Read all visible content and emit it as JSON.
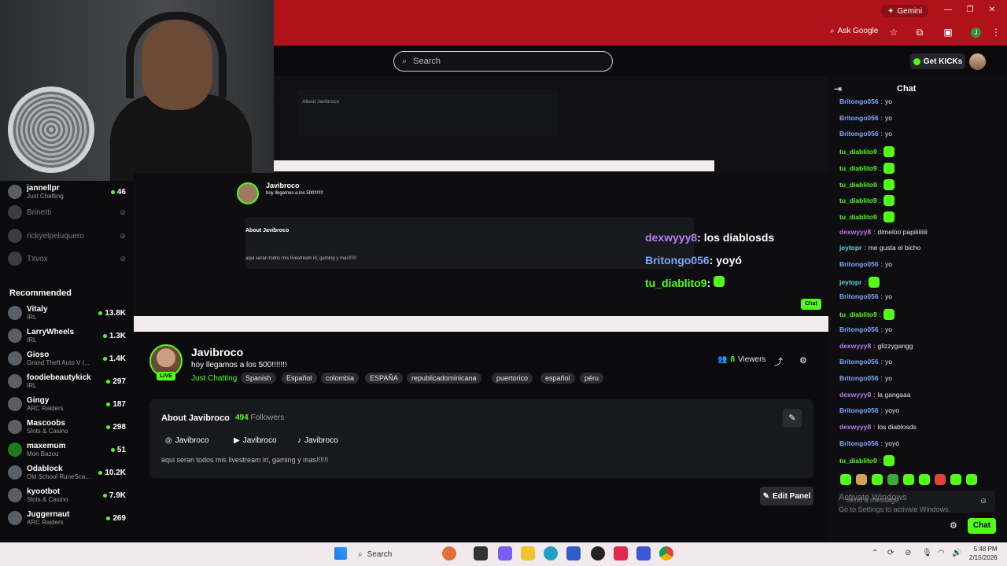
{
  "browser": {
    "gemini_label": "Gemini",
    "ask_google_label": "Ask Google",
    "profile_initial": "J"
  },
  "header": {
    "search_placeholder": "Search",
    "get_kicks_label": "Get KICKs"
  },
  "sidebar": {
    "following": [
      {
        "name": "jannellpr",
        "category": "Just Chatting",
        "viewers": "46",
        "live": true
      },
      {
        "name": "Brinetti",
        "live": false
      },
      {
        "name": "rickyelpeluquero",
        "live": false
      },
      {
        "name": "Txvox",
        "live": false
      }
    ],
    "recommended_label": "Recommended",
    "recommended": [
      {
        "name": "Vitaly",
        "category": "IRL",
        "viewers": "13.8K"
      },
      {
        "name": "LarryWheels",
        "category": "IRL",
        "viewers": "1.3K"
      },
      {
        "name": "Gioso",
        "category": "Grand Theft Auto V (...",
        "viewers": "1.4K"
      },
      {
        "name": "foodiebeautykick",
        "category": "IRL",
        "viewers": "297"
      },
      {
        "name": "Gingy",
        "category": "ARC Raiders",
        "viewers": "187"
      },
      {
        "name": "Mascoobs",
        "category": "Slots & Casino",
        "viewers": "298"
      },
      {
        "name": "maxemum",
        "category": "Mon Bazou",
        "viewers": "51"
      },
      {
        "name": "Odablock",
        "category": "Old School RuneSca...",
        "viewers": "10.2K"
      },
      {
        "name": "kyootbot",
        "category": "Slots & Casino",
        "viewers": "7.9K"
      },
      {
        "name": "Juggernaut",
        "category": "ARC Raiders",
        "viewers": "269"
      }
    ]
  },
  "channel": {
    "name": "Javibroco",
    "title": "hoy llegamos a los 500!!!!!!!",
    "category": "Just Chatting",
    "live_badge": "LIVE",
    "tags": [
      "Spanish",
      "Español",
      "colombia",
      "ESPAÑA",
      "republicadominicana",
      "puertorico",
      "español",
      "péru"
    ],
    "viewers_count": "8",
    "viewers_label": "Viewers",
    "about_title": "About Javibroco",
    "followers_count": "494",
    "followers_label": "Followers",
    "socials": [
      "Javibroco",
      "Javibroco",
      "Javibroco"
    ],
    "bio": "aqui seran todos mis livestream irl, gaming y mas!!!!!!",
    "edit_panel_label": "Edit Panel"
  },
  "overlay_echo": [
    {
      "user": "dexwyyy8",
      "text": ": los diablosds",
      "color": "#b77cf6"
    },
    {
      "user": "Britongo056",
      "text": ": yoyó",
      "color": "#7ea6ff"
    },
    {
      "user": "tu_diablito9",
      "text": ":",
      "color": "#53fc18"
    }
  ],
  "chat": {
    "title": "Chat",
    "messages": [
      {
        "user": "Britongo056",
        "text": "yo",
        "color": "#7ea6ff"
      },
      {
        "user": "Britongo056",
        "text": "yo",
        "color": "#7ea6ff"
      },
      {
        "user": "Britongo056",
        "text": "yo",
        "color": "#7ea6ff"
      },
      {
        "user": "tu_diablito9",
        "text": "",
        "color": "#53fc18",
        "emote": true
      },
      {
        "user": "tu_diablito9",
        "text": "",
        "color": "#53fc18",
        "emote": true
      },
      {
        "user": "tu_diablito9",
        "text": "",
        "color": "#53fc18",
        "emote": true
      },
      {
        "user": "tu_diablito9",
        "text": "",
        "color": "#53fc18",
        "emote": true
      },
      {
        "user": "tu_diablito9",
        "text": "",
        "color": "#53fc18",
        "emote": true
      },
      {
        "user": "dexwyyy8",
        "text": "dimeloo papiiiiiiiii",
        "color": "#b77cf6"
      },
      {
        "user": "jeytopr",
        "text": "me gusta el bicho",
        "color": "#5fd4e6"
      },
      {
        "user": "Britongo056",
        "text": "yo",
        "color": "#7ea6ff"
      },
      {
        "user": "jeytopr",
        "text": "",
        "color": "#5fd4e6",
        "emote": true
      },
      {
        "user": "Britongo056",
        "text": "yo",
        "color": "#7ea6ff"
      },
      {
        "user": "tu_diablito9",
        "text": "",
        "color": "#53fc18",
        "emote": true
      },
      {
        "user": "Britongo056",
        "text": "yo",
        "color": "#7ea6ff"
      },
      {
        "user": "dexwyyy8",
        "text": "glizzygangg",
        "color": "#b77cf6"
      },
      {
        "user": "Britongo056",
        "text": "yo",
        "color": "#7ea6ff"
      },
      {
        "user": "Britongo056",
        "text": "yo",
        "color": "#7ea6ff"
      },
      {
        "user": "dexwyyy8",
        "text": "la gangaaa",
        "color": "#b77cf6"
      },
      {
        "user": "Britongo056",
        "text": "yoyo",
        "color": "#7ea6ff"
      },
      {
        "user": "dexwyyy8",
        "text": "los diablosds",
        "color": "#b77cf6"
      },
      {
        "user": "Britongo056",
        "text": "yoyó",
        "color": "#7ea6ff"
      },
      {
        "user": "tu_diablito9",
        "text": "",
        "color": "#53fc18",
        "emote": true
      }
    ],
    "input_placeholder": "Send a message",
    "send_label": "Chat",
    "watermark_title": "Activate Windows",
    "watermark_sub": "Go to Settings to activate Windows."
  },
  "taskbar": {
    "search_label": "Search",
    "time": "5:48 PM",
    "date": "2/15/2026"
  }
}
